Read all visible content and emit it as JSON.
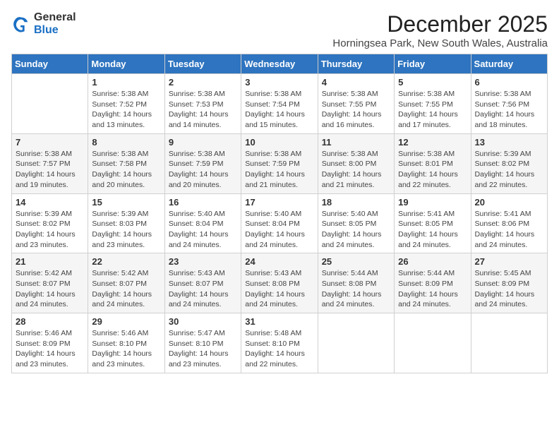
{
  "logo": {
    "general": "General",
    "blue": "Blue"
  },
  "header": {
    "month": "December 2025",
    "location": "Horningsea Park, New South Wales, Australia"
  },
  "days_of_week": [
    "Sunday",
    "Monday",
    "Tuesday",
    "Wednesday",
    "Thursday",
    "Friday",
    "Saturday"
  ],
  "weeks": [
    [
      {
        "day": "",
        "sunrise": "",
        "sunset": "",
        "daylight": ""
      },
      {
        "day": "1",
        "sunrise": "Sunrise: 5:38 AM",
        "sunset": "Sunset: 7:52 PM",
        "daylight": "Daylight: 14 hours and 13 minutes."
      },
      {
        "day": "2",
        "sunrise": "Sunrise: 5:38 AM",
        "sunset": "Sunset: 7:53 PM",
        "daylight": "Daylight: 14 hours and 14 minutes."
      },
      {
        "day": "3",
        "sunrise": "Sunrise: 5:38 AM",
        "sunset": "Sunset: 7:54 PM",
        "daylight": "Daylight: 14 hours and 15 minutes."
      },
      {
        "day": "4",
        "sunrise": "Sunrise: 5:38 AM",
        "sunset": "Sunset: 7:55 PM",
        "daylight": "Daylight: 14 hours and 16 minutes."
      },
      {
        "day": "5",
        "sunrise": "Sunrise: 5:38 AM",
        "sunset": "Sunset: 7:55 PM",
        "daylight": "Daylight: 14 hours and 17 minutes."
      },
      {
        "day": "6",
        "sunrise": "Sunrise: 5:38 AM",
        "sunset": "Sunset: 7:56 PM",
        "daylight": "Daylight: 14 hours and 18 minutes."
      }
    ],
    [
      {
        "day": "7",
        "sunrise": "Sunrise: 5:38 AM",
        "sunset": "Sunset: 7:57 PM",
        "daylight": "Daylight: 14 hours and 19 minutes."
      },
      {
        "day": "8",
        "sunrise": "Sunrise: 5:38 AM",
        "sunset": "Sunset: 7:58 PM",
        "daylight": "Daylight: 14 hours and 20 minutes."
      },
      {
        "day": "9",
        "sunrise": "Sunrise: 5:38 AM",
        "sunset": "Sunset: 7:59 PM",
        "daylight": "Daylight: 14 hours and 20 minutes."
      },
      {
        "day": "10",
        "sunrise": "Sunrise: 5:38 AM",
        "sunset": "Sunset: 7:59 PM",
        "daylight": "Daylight: 14 hours and 21 minutes."
      },
      {
        "day": "11",
        "sunrise": "Sunrise: 5:38 AM",
        "sunset": "Sunset: 8:00 PM",
        "daylight": "Daylight: 14 hours and 21 minutes."
      },
      {
        "day": "12",
        "sunrise": "Sunrise: 5:38 AM",
        "sunset": "Sunset: 8:01 PM",
        "daylight": "Daylight: 14 hours and 22 minutes."
      },
      {
        "day": "13",
        "sunrise": "Sunrise: 5:39 AM",
        "sunset": "Sunset: 8:02 PM",
        "daylight": "Daylight: 14 hours and 22 minutes."
      }
    ],
    [
      {
        "day": "14",
        "sunrise": "Sunrise: 5:39 AM",
        "sunset": "Sunset: 8:02 PM",
        "daylight": "Daylight: 14 hours and 23 minutes."
      },
      {
        "day": "15",
        "sunrise": "Sunrise: 5:39 AM",
        "sunset": "Sunset: 8:03 PM",
        "daylight": "Daylight: 14 hours and 23 minutes."
      },
      {
        "day": "16",
        "sunrise": "Sunrise: 5:40 AM",
        "sunset": "Sunset: 8:04 PM",
        "daylight": "Daylight: 14 hours and 24 minutes."
      },
      {
        "day": "17",
        "sunrise": "Sunrise: 5:40 AM",
        "sunset": "Sunset: 8:04 PM",
        "daylight": "Daylight: 14 hours and 24 minutes."
      },
      {
        "day": "18",
        "sunrise": "Sunrise: 5:40 AM",
        "sunset": "Sunset: 8:05 PM",
        "daylight": "Daylight: 14 hours and 24 minutes."
      },
      {
        "day": "19",
        "sunrise": "Sunrise: 5:41 AM",
        "sunset": "Sunset: 8:05 PM",
        "daylight": "Daylight: 14 hours and 24 minutes."
      },
      {
        "day": "20",
        "sunrise": "Sunrise: 5:41 AM",
        "sunset": "Sunset: 8:06 PM",
        "daylight": "Daylight: 14 hours and 24 minutes."
      }
    ],
    [
      {
        "day": "21",
        "sunrise": "Sunrise: 5:42 AM",
        "sunset": "Sunset: 8:07 PM",
        "daylight": "Daylight: 14 hours and 24 minutes."
      },
      {
        "day": "22",
        "sunrise": "Sunrise: 5:42 AM",
        "sunset": "Sunset: 8:07 PM",
        "daylight": "Daylight: 14 hours and 24 minutes."
      },
      {
        "day": "23",
        "sunrise": "Sunrise: 5:43 AM",
        "sunset": "Sunset: 8:07 PM",
        "daylight": "Daylight: 14 hours and 24 minutes."
      },
      {
        "day": "24",
        "sunrise": "Sunrise: 5:43 AM",
        "sunset": "Sunset: 8:08 PM",
        "daylight": "Daylight: 14 hours and 24 minutes."
      },
      {
        "day": "25",
        "sunrise": "Sunrise: 5:44 AM",
        "sunset": "Sunset: 8:08 PM",
        "daylight": "Daylight: 14 hours and 24 minutes."
      },
      {
        "day": "26",
        "sunrise": "Sunrise: 5:44 AM",
        "sunset": "Sunset: 8:09 PM",
        "daylight": "Daylight: 14 hours and 24 minutes."
      },
      {
        "day": "27",
        "sunrise": "Sunrise: 5:45 AM",
        "sunset": "Sunset: 8:09 PM",
        "daylight": "Daylight: 14 hours and 24 minutes."
      }
    ],
    [
      {
        "day": "28",
        "sunrise": "Sunrise: 5:46 AM",
        "sunset": "Sunset: 8:09 PM",
        "daylight": "Daylight: 14 hours and 23 minutes."
      },
      {
        "day": "29",
        "sunrise": "Sunrise: 5:46 AM",
        "sunset": "Sunset: 8:10 PM",
        "daylight": "Daylight: 14 hours and 23 minutes."
      },
      {
        "day": "30",
        "sunrise": "Sunrise: 5:47 AM",
        "sunset": "Sunset: 8:10 PM",
        "daylight": "Daylight: 14 hours and 23 minutes."
      },
      {
        "day": "31",
        "sunrise": "Sunrise: 5:48 AM",
        "sunset": "Sunset: 8:10 PM",
        "daylight": "Daylight: 14 hours and 22 minutes."
      },
      {
        "day": "",
        "sunrise": "",
        "sunset": "",
        "daylight": ""
      },
      {
        "day": "",
        "sunrise": "",
        "sunset": "",
        "daylight": ""
      },
      {
        "day": "",
        "sunrise": "",
        "sunset": "",
        "daylight": ""
      }
    ]
  ]
}
